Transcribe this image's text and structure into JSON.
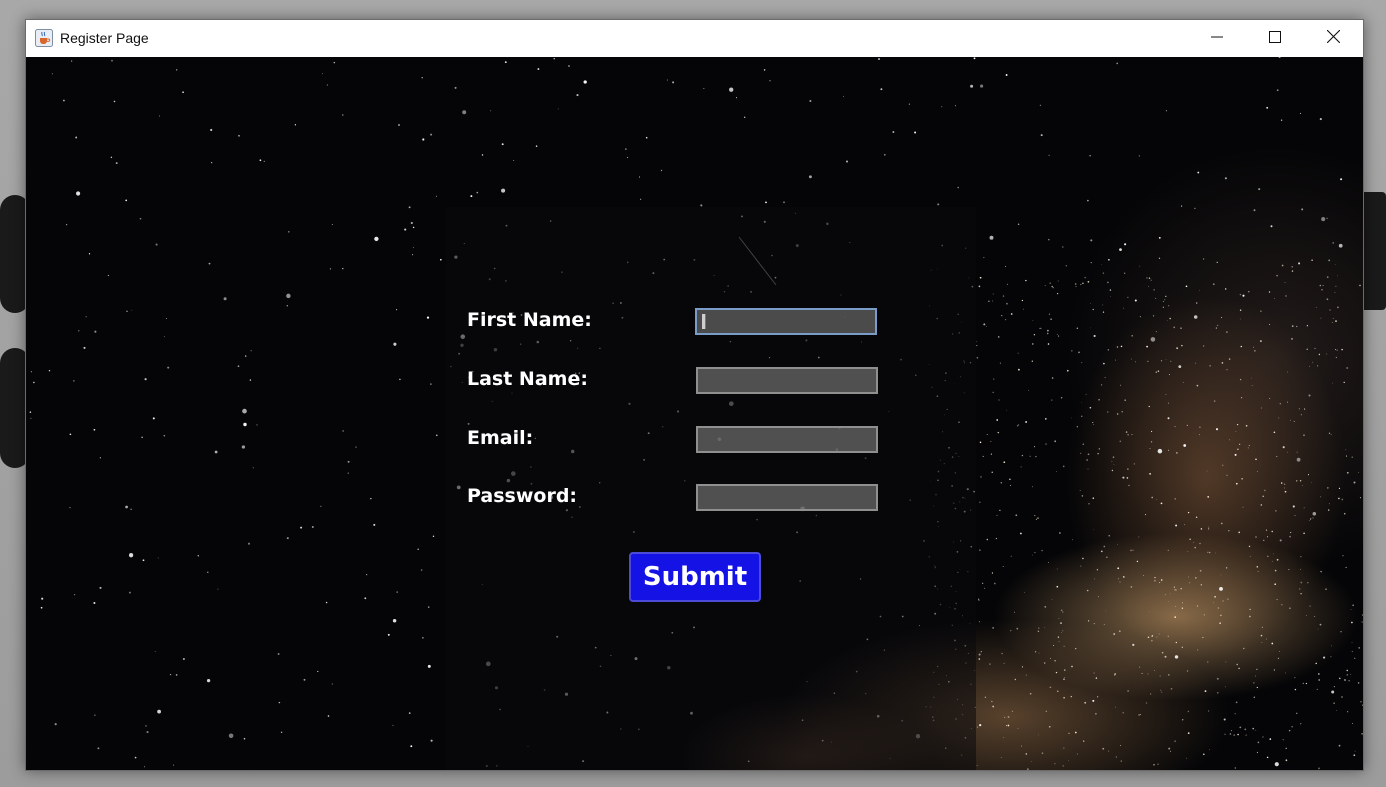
{
  "window": {
    "title": "Register Page",
    "icon": "java-cup-icon",
    "controls": {
      "minimize_icon": "minimize-icon",
      "maximize_icon": "maximize-icon",
      "close_icon": "close-icon"
    }
  },
  "form": {
    "fields": [
      {
        "label": "First Name:",
        "value": "",
        "focused": true
      },
      {
        "label": "Last Name:",
        "value": "",
        "focused": false
      },
      {
        "label": "Email:",
        "value": "",
        "focused": false
      },
      {
        "label": "Password:",
        "value": "",
        "focused": false
      }
    ],
    "submit_label": "Submit"
  },
  "colors": {
    "submit_bg": "#1512e6",
    "focus_border": "#7a9cc9",
    "label_text": "#ffffff"
  }
}
